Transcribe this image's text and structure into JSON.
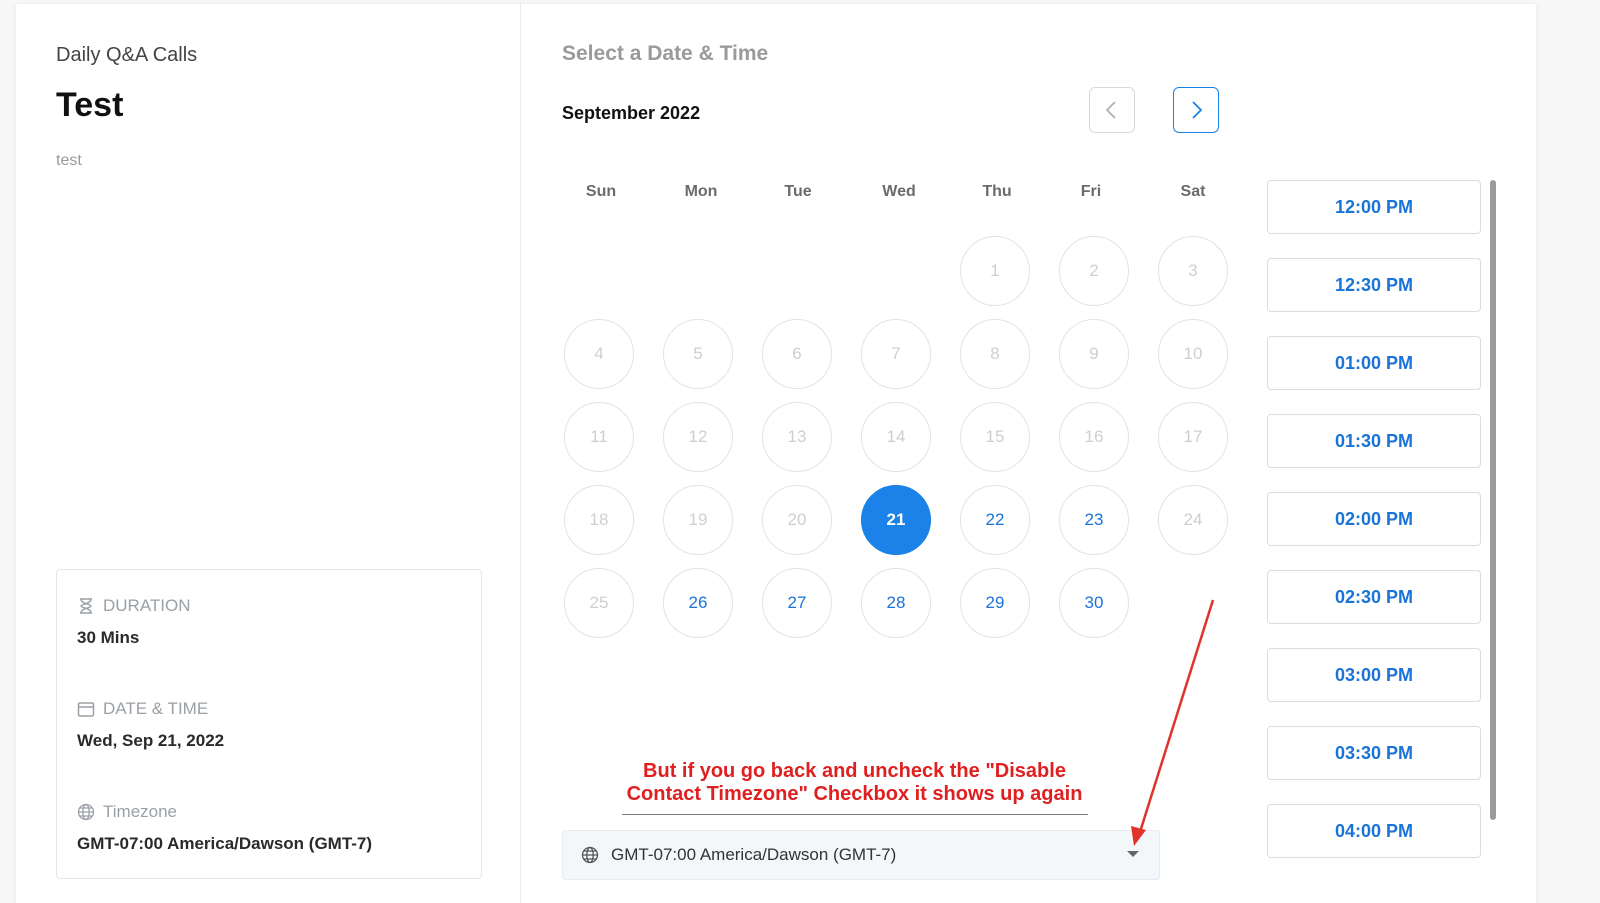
{
  "event": {
    "group": "Daily Q&A Calls",
    "title": "Test",
    "description": "test"
  },
  "details": {
    "duration_label": "DURATION",
    "duration_value": "30 Mins",
    "datetime_label": "DATE & TIME",
    "datetime_value": "Wed, Sep 21, 2022",
    "timezone_label": "Timezone",
    "timezone_value": "GMT-07:00 America/Dawson (GMT-7)"
  },
  "calendar": {
    "heading": "Select a Date & Time",
    "month": "September 2022",
    "weekdays": [
      "Sun",
      "Mon",
      "Tue",
      "Wed",
      "Thu",
      "Fri",
      "Sat"
    ],
    "days": {
      "1": "1",
      "2": "2",
      "3": "3",
      "4": "4",
      "5": "5",
      "6": "6",
      "7": "7",
      "8": "8",
      "9": "9",
      "10": "10",
      "11": "11",
      "12": "12",
      "13": "13",
      "14": "14",
      "15": "15",
      "16": "16",
      "17": "17",
      "18": "18",
      "19": "19",
      "20": "20",
      "21": "21",
      "22": "22",
      "23": "23",
      "24": "24",
      "25": "25",
      "26": "26",
      "27": "27",
      "28": "28",
      "29": "29",
      "30": "30"
    },
    "selected_day": "21",
    "available_days": [
      "22",
      "23",
      "26",
      "27",
      "28",
      "29",
      "30"
    ]
  },
  "annotation": {
    "line1": "But if you go back and uncheck the \"Disable",
    "line2": "Contact Timezone\" Checkbox it shows up again"
  },
  "timezone_select": {
    "value": "GMT-07:00 America/Dawson (GMT-7)"
  },
  "time_slots": [
    "12:00 PM",
    "12:30 PM",
    "01:00 PM",
    "01:30 PM",
    "02:00 PM",
    "02:30 PM",
    "03:00 PM",
    "03:30 PM",
    "04:00 PM"
  ],
  "colors": {
    "accent": "#1a82e8",
    "annotation": "#e02020"
  },
  "icons": {
    "duration": "hourglass-icon",
    "datetime": "calendar-icon",
    "timezone": "globe-icon",
    "prev": "chevron-left-icon",
    "next": "chevron-right-icon",
    "caret": "caret-down-icon"
  }
}
